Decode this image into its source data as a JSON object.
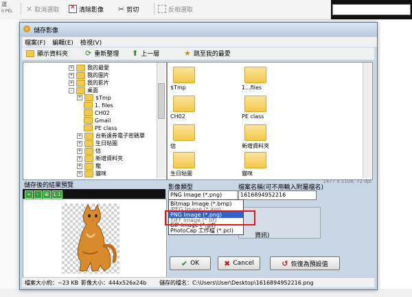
{
  "background": {
    "toolbar": {
      "buttons": [
        {
          "label": "取消選取",
          "icon": "x-icon",
          "disabled": true
        },
        {
          "label": "清除影像",
          "icon": "clear-image-icon",
          "disabled": false
        },
        {
          "label": "剪切",
          "icon": "scissors-icon",
          "disabled": false
        },
        {
          "label": "反相選取",
          "icon": "invert-select-icon",
          "disabled": true
        }
      ],
      "left_top": "選",
      "left_bottom": "0 PEL"
    }
  },
  "dialog": {
    "title": "儲存影像",
    "menu": [
      "檔案(F)",
      "編輯(E)",
      "檢視(V)"
    ],
    "toolbar": [
      "顯示資料夾",
      "重新整理",
      "上一層",
      "跳至我的最愛"
    ],
    "tree": [
      {
        "label": "我的最愛",
        "level": 1,
        "expander": "+"
      },
      {
        "label": "我的圖片",
        "level": 1,
        "expander": "+"
      },
      {
        "label": "我的影片",
        "level": 1,
        "expander": "+"
      },
      {
        "label": "桌面",
        "level": 1,
        "expander": "-"
      },
      {
        "label": "$Tmp",
        "level": 2,
        "expander": "+"
      },
      {
        "label": "1. files",
        "level": 2,
        "expander": ""
      },
      {
        "label": "CH02",
        "level": 2,
        "expander": ""
      },
      {
        "label": "Gmail",
        "level": 2,
        "expander": ""
      },
      {
        "label": "PE class",
        "level": 2,
        "expander": ""
      },
      {
        "label": "台新遠券電子密碼單",
        "level": 2,
        "expander": "+"
      },
      {
        "label": "生日貼圖",
        "level": 2,
        "expander": "+"
      },
      {
        "label": "估",
        "level": 2,
        "expander": "+"
      },
      {
        "label": "新增資料夾",
        "level": 2,
        "expander": "+"
      },
      {
        "label": "龍",
        "level": 2,
        "expander": "+"
      },
      {
        "label": "貓咪",
        "level": 2,
        "expander": "+"
      }
    ],
    "files": [
      {
        "label": "$Tmp"
      },
      {
        "label": "1...files"
      },
      {
        "label": "CH02"
      },
      {
        "label": "PE class"
      },
      {
        "label": "估"
      },
      {
        "label": "新增資料夾"
      },
      {
        "label": "生日貼圖"
      },
      {
        "label": "貓咪"
      }
    ],
    "file_dims": "1477 x 1108, 72 dpi",
    "preview_label": "儲存後的結果預覽",
    "preview_tools": [
      "+",
      "-",
      "⊞",
      "1:1"
    ],
    "format_label": "影像類型",
    "format_selected": "PNG Image (*.png)",
    "format_options": [
      "Bitmap Image (*.bmp)",
      "JPEG Image (*.jpg)",
      "PNG Image (*.png)",
      "TIFF Image (*.tif)",
      "GIF Image (*.gif)",
      "PhotoCap 工作檔 (*.pcl)"
    ],
    "format_highlight_index": 2,
    "filename_label": "檔案名稱(可不用輸入附屬檔名)",
    "filename_value": "1616894952216",
    "options_text": "資訊)",
    "buttons": {
      "ok": "OK",
      "cancel": "Cancel",
      "default": "恢復為預設值"
    },
    "status": {
      "size": "檔案大小約：~23 KB",
      "dims": "影像大小：444x526x24b",
      "path": "儲存的檔名：C:\\Users\\User\\Desktop\\1616894952216.png"
    }
  }
}
